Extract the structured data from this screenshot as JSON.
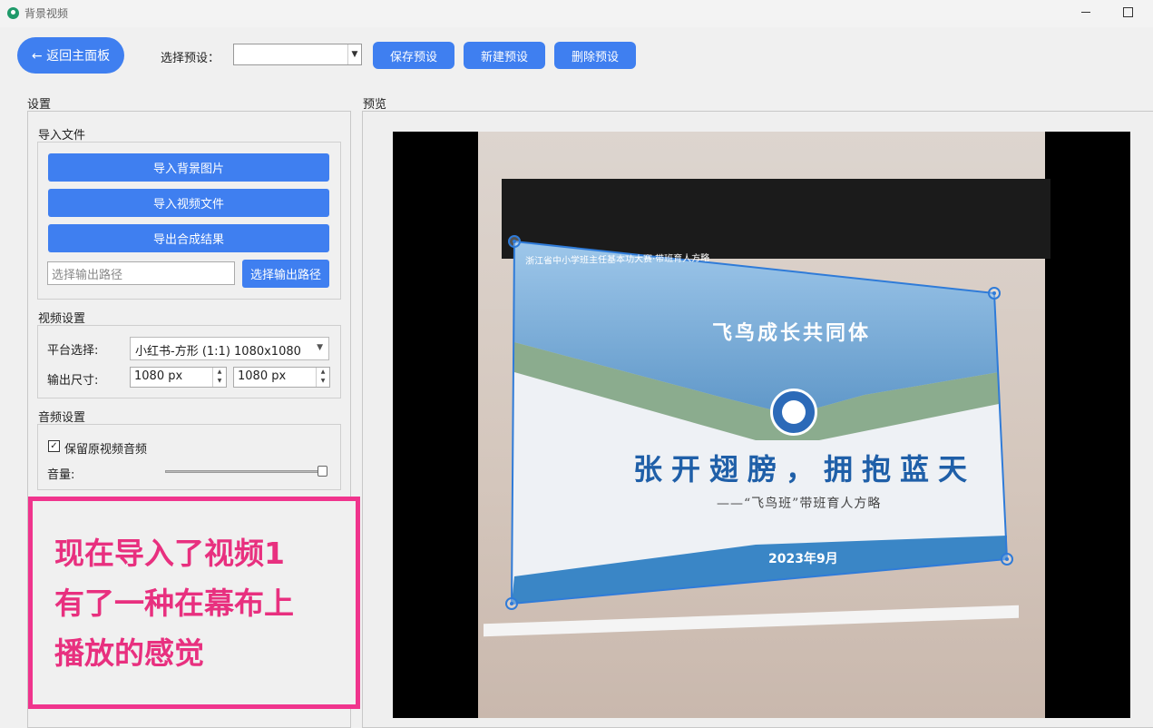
{
  "window": {
    "title": "背景视频"
  },
  "toolbar": {
    "back_label": "← 返回主面板",
    "preset_label": "选择预设：",
    "preset_value": "",
    "save_label": "保存预设",
    "new_label": "新建预设",
    "delete_label": "删除预设"
  },
  "settings": {
    "title": "设置",
    "import": {
      "title": "导入文件",
      "import_bg_label": "导入背景图片",
      "import_video_label": "导入视频文件",
      "export_label": "导出合成结果",
      "output_path_placeholder": "选择输出路径",
      "choose_path_label": "选择输出路径"
    },
    "video": {
      "title": "视频设置",
      "platform_label": "平台选择:",
      "platform_value": "小红书-方形 (1:1) 1080x1080",
      "size_label": "输出尺寸:",
      "width_value": "1080 px",
      "height_value": "1080 px"
    },
    "audio": {
      "title": "音频设置",
      "keep_audio_label": "保留原视频音频",
      "keep_audio_checked": true,
      "volume_label": "音量:",
      "volume_level": 1.0
    }
  },
  "preview": {
    "title": "预览",
    "slide": {
      "header_line": "浙江省中小学班主任基本功大赛·带班育人方略",
      "title": "飞鸟成长共同体",
      "main_text": "张开翅膀，拥抱蓝天",
      "subtitle": "——“飞鸟班”带班育人方略",
      "date": "2023年9月"
    }
  },
  "annotation": {
    "text_line1": "现在导入了视频1",
    "text_line2": "有了一种在幕布上",
    "text_line3": "播放的感觉",
    "border_color": "#f0348d"
  },
  "colors": {
    "accent": "#3f7ff0",
    "handle": "#2f7bd8"
  }
}
